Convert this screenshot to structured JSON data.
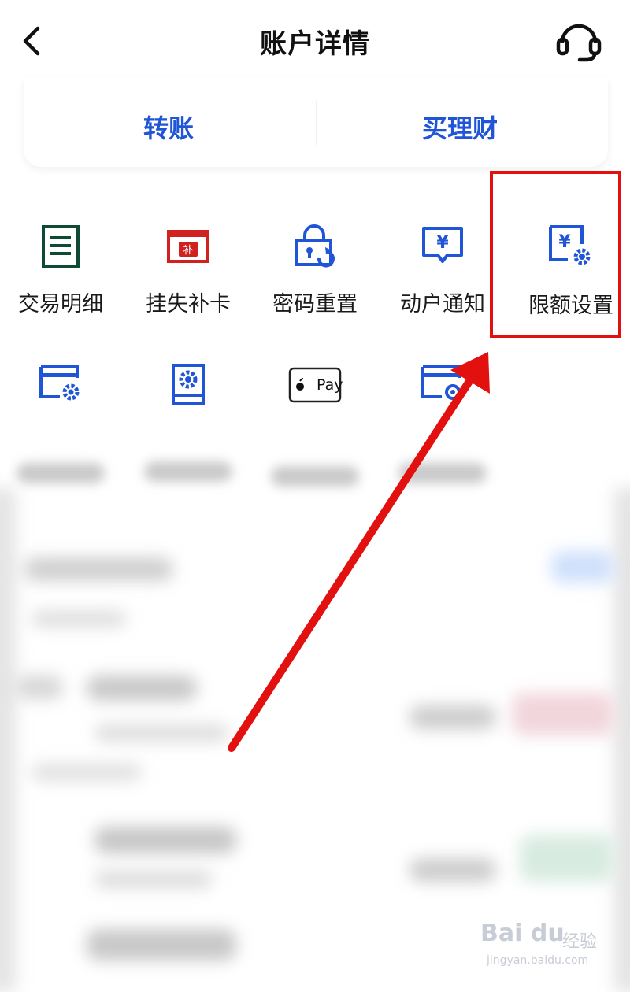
{
  "header": {
    "title": "账户详情",
    "back_icon": "chevron-left-icon",
    "support_icon": "headset-icon"
  },
  "actions": {
    "transfer": "转账",
    "buy_finance": "买理财"
  },
  "grid": {
    "row1": [
      {
        "label": "交易明细",
        "icon": "list-icon"
      },
      {
        "label": "挂失补卡",
        "icon": "card-replace-icon"
      },
      {
        "label": "密码重置",
        "icon": "lock-reset-icon"
      },
      {
        "label": "动户通知",
        "icon": "yuan-message-icon"
      },
      {
        "label": "限额设置",
        "icon": "yuan-settings-icon"
      }
    ],
    "row2": [
      {
        "icon": "card-settings-icon"
      },
      {
        "icon": "device-settings-icon"
      },
      {
        "icon": "apple-pay-icon",
        "badge_text": "Pay"
      },
      {
        "icon": "card-record-icon"
      }
    ]
  },
  "watermark": {
    "logo": "Bai du",
    "sub": "经验",
    "url": "jingyan.baidu.com"
  },
  "colors": {
    "accent_blue": "#1f55d6",
    "highlight_red": "#e31010",
    "icon_green": "#0f4a32",
    "icon_red": "#d02020"
  }
}
